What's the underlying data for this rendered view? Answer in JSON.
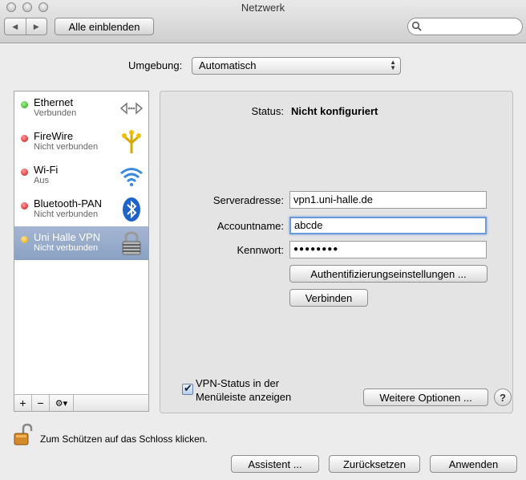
{
  "window": {
    "title": "Netzwerk"
  },
  "toolbar": {
    "back_glyph": "◀",
    "forward_glyph": "▶",
    "show_all_label": "Alle einblenden",
    "search_placeholder": ""
  },
  "environment": {
    "label": "Umgebung:",
    "value": "Automatisch"
  },
  "services": [
    {
      "name": "Ethernet",
      "status": "Verbunden",
      "status_color": "green",
      "icon": "ethernet-arrows-icon"
    },
    {
      "name": "FireWire",
      "status": "Nicht verbunden",
      "status_color": "red",
      "icon": "firewire-icon"
    },
    {
      "name": "Wi-Fi",
      "status": "Aus",
      "status_color": "red",
      "icon": "wifi-icon"
    },
    {
      "name": "Bluetooth-PAN",
      "status": "Nicht verbunden",
      "status_color": "red",
      "icon": "bluetooth-icon"
    },
    {
      "name": "Uni Halle VPN",
      "status": "Nicht verbunden",
      "status_color": "yellow",
      "icon": "vpn-lock-icon",
      "selected": true
    }
  ],
  "sidebar_controls": {
    "add": "+",
    "remove": "−",
    "gear": "⚙▾"
  },
  "detail": {
    "status_label": "Status:",
    "status_value": "Nicht konfiguriert",
    "server_label": "Serveradresse:",
    "server_value": "vpn1.uni-halle.de",
    "account_label": "Accountname:",
    "account_value": "abcde",
    "password_label": "Kennwort:",
    "password_value": "●●●●●●●●",
    "auth_button": "Authentifizierungseinstellungen ...",
    "connect_button": "Verbinden",
    "vpn_status_line1": "VPN-Status in der",
    "vpn_status_line2": "Menüleiste anzeigen",
    "vpn_status_checked": true,
    "advanced_button": "Weitere Optionen ...",
    "help_glyph": "?"
  },
  "footer": {
    "lock_hint": "Zum Schützen auf das Schloss klicken.",
    "assistant_button": "Assistent ...",
    "revert_button": "Zurücksetzen",
    "apply_button": "Anwenden"
  },
  "colors": {
    "selection": "#8aa1c3",
    "focus_ring": "#6c9ad8",
    "green": "#2aa31b",
    "red": "#cc1212",
    "yellow": "#e0a000"
  }
}
